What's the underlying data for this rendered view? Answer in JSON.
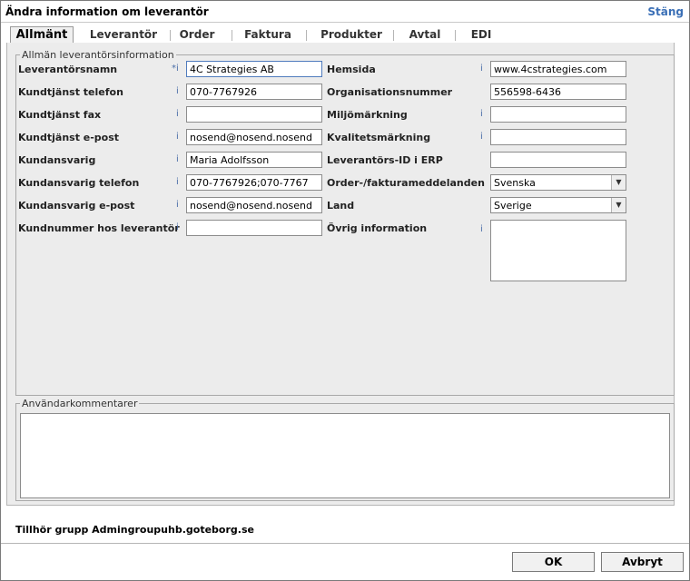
{
  "window": {
    "title": "Ändra information om leverantör",
    "close_label": "Stäng"
  },
  "tabs": [
    "Allmänt",
    "Leverantör",
    "Order",
    "Faktura",
    "Produkter",
    "Avtal",
    "EDI"
  ],
  "general": {
    "legend": "Allmän leverantörsinformation",
    "info_marker": "i",
    "required_marker": "*i",
    "supplier_name": {
      "label": "Leverantörsnamn",
      "value": "4C Strategies AB"
    },
    "cs_phone": {
      "label": "Kundtjänst telefon",
      "value": "070-7767926"
    },
    "cs_fax": {
      "label": "Kundtjänst fax",
      "value": ""
    },
    "cs_email": {
      "label": "Kundtjänst e-post",
      "value": "nosend@nosend.nosend"
    },
    "account_manager": {
      "label": "Kundansvarig",
      "value": "Maria Adolfsson"
    },
    "am_phone": {
      "label": "Kundansvarig telefon",
      "value": "070-7767926;070-7767"
    },
    "am_email": {
      "label": "Kundansvarig e-post",
      "value": "nosend@nosend.nosend"
    },
    "customer_number": {
      "label": "Kundnummer hos leverantör",
      "value": ""
    },
    "website": {
      "label": "Hemsida",
      "value": "www.4cstrategies.com"
    },
    "org_number": {
      "label": "Organisationsnummer",
      "value": "556598-6436"
    },
    "eco_label": {
      "label": "Miljömärkning",
      "value": ""
    },
    "quality_label": {
      "label": "Kvalitetsmärkning",
      "value": ""
    },
    "erp_id": {
      "label": "Leverantörs-ID i ERP",
      "value": ""
    },
    "message_language": {
      "label": "Order-/fakturameddelanden",
      "value": "Svenska"
    },
    "country": {
      "label": "Land",
      "value": "Sverige"
    },
    "other_info": {
      "label": "Övrig information",
      "value": ""
    }
  },
  "comments": {
    "legend": "Användarkommentarer"
  },
  "group": {
    "text": "Tillhör grupp  Admingroupuhb.goteborg.se"
  },
  "buttons": {
    "ok": "OK",
    "cancel": "Avbryt"
  }
}
